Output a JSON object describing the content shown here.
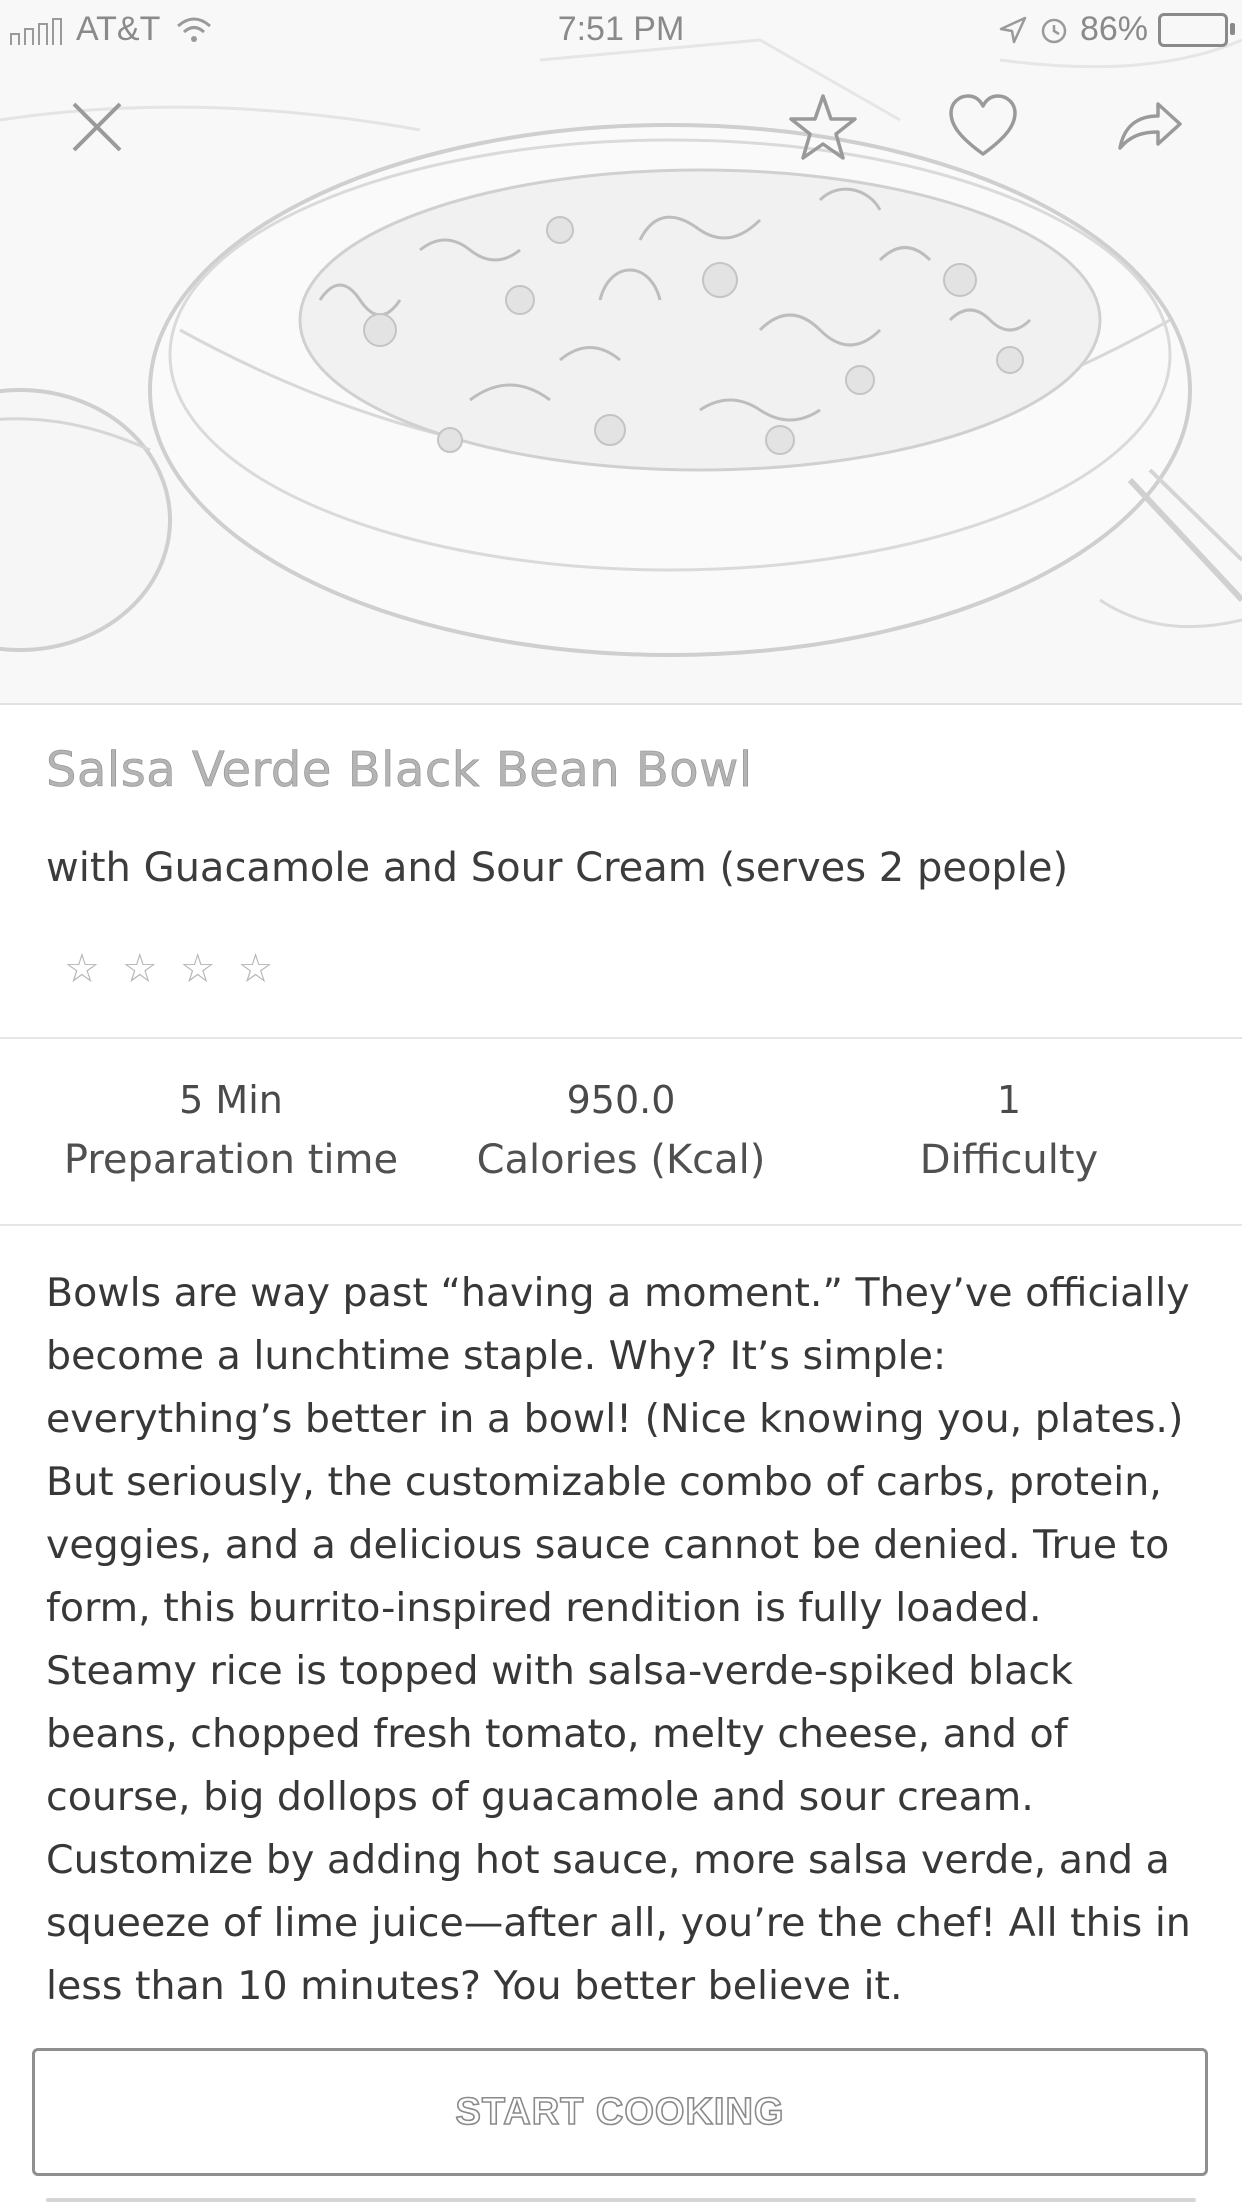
{
  "status_bar": {
    "carrier": "AT&T",
    "time": "7:51 PM",
    "battery": "86%"
  },
  "hero": {
    "icons": [
      "close-icon",
      "star-icon",
      "heart-icon",
      "share-icon"
    ]
  },
  "recipe": {
    "title": "Salsa Verde Black Bean Bowl",
    "subtitle": "with Guacamole and Sour Cream (serves 2 people)",
    "rating_stars": [
      "☆",
      "☆",
      "☆",
      "☆"
    ],
    "stats": [
      {
        "value": "5 Min",
        "label": "Preparation time"
      },
      {
        "value": "950.0",
        "label": "Calories (Kcal)"
      },
      {
        "value": "1",
        "label": "Difficulty"
      }
    ],
    "description_lines": [
      "Bowls are way past “having a moment.” They’ve officially",
      "become a lunchtime staple. Why? It’s simple:",
      "everything’s better in a bowl! (Nice knowing you, plates.)",
      "But seriously, the customizable combo of carbs, protein,",
      "veggies, and a delicious sauce cannot be denied. True to",
      "form, this burrito-inspired rendition is fully loaded.",
      "Steamy rice is topped with salsa-verde-spiked black",
      "beans, chopped fresh tomato, melty cheese, and of",
      "course, big dollops of guacamole and sour cream.",
      "Customize by adding hot sauce, more salsa verde, and a",
      "squeeze of lime juice—after all, you’re the chef! All this in",
      "less than 10 minutes? You better believe it."
    ]
  },
  "actions": {
    "start_cooking": "START COOKING"
  }
}
